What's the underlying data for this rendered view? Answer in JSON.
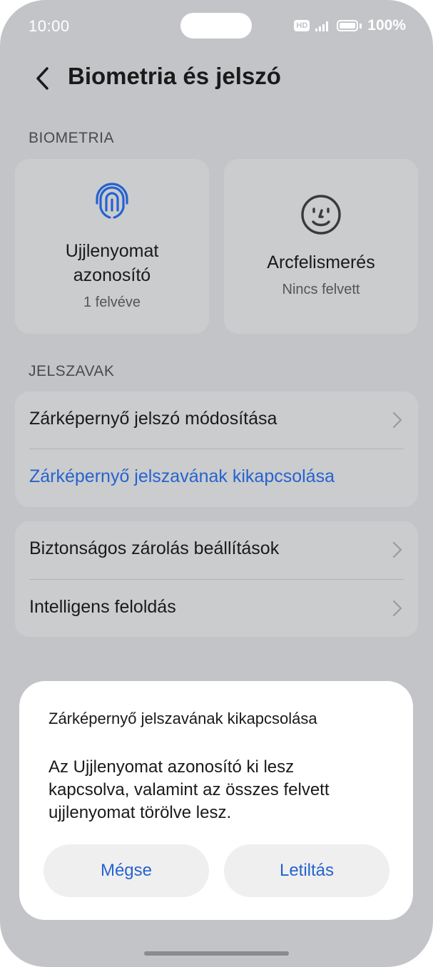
{
  "status_bar": {
    "time": "10:00",
    "hd_badge": "HD",
    "battery": "100%"
  },
  "header": {
    "title": "Biometria és jelszó"
  },
  "biometrics": {
    "section_label": "BIOMETRIA",
    "fingerprint": {
      "title_line1": "Ujjlenyomat",
      "title_line2": "azonosító",
      "status": "1 felvéve",
      "icon": "fingerprint-icon"
    },
    "face": {
      "title": "Arcfelismerés",
      "status": "Nincs felvett",
      "icon": "face-icon"
    }
  },
  "passwords": {
    "section_label": "JELSZAVAK",
    "change_password": "Zárképernyő jelszó módosítása",
    "disable_password": "Zárképernyő jelszavának kikapcsolása"
  },
  "more": {
    "secure_lock": "Biztonságos zárolás beállítások",
    "smart_unlock": "Intelligens feloldás"
  },
  "dialog": {
    "title": "Zárképernyő jelszavának kikapcsolása",
    "message_line1": "Az Ujjlenyomat azonosító ki lesz",
    "message_line2": "kapcsolva, valamint az összes felvett",
    "message_line3": "ujjlenyomat törölve lesz.",
    "cancel_label": "Mégse",
    "confirm_label": "Letiltás"
  },
  "colors": {
    "background": "#c3c4c7",
    "card": "#cbccce",
    "accent": "#2563d0",
    "dialog": "#ffffff"
  }
}
